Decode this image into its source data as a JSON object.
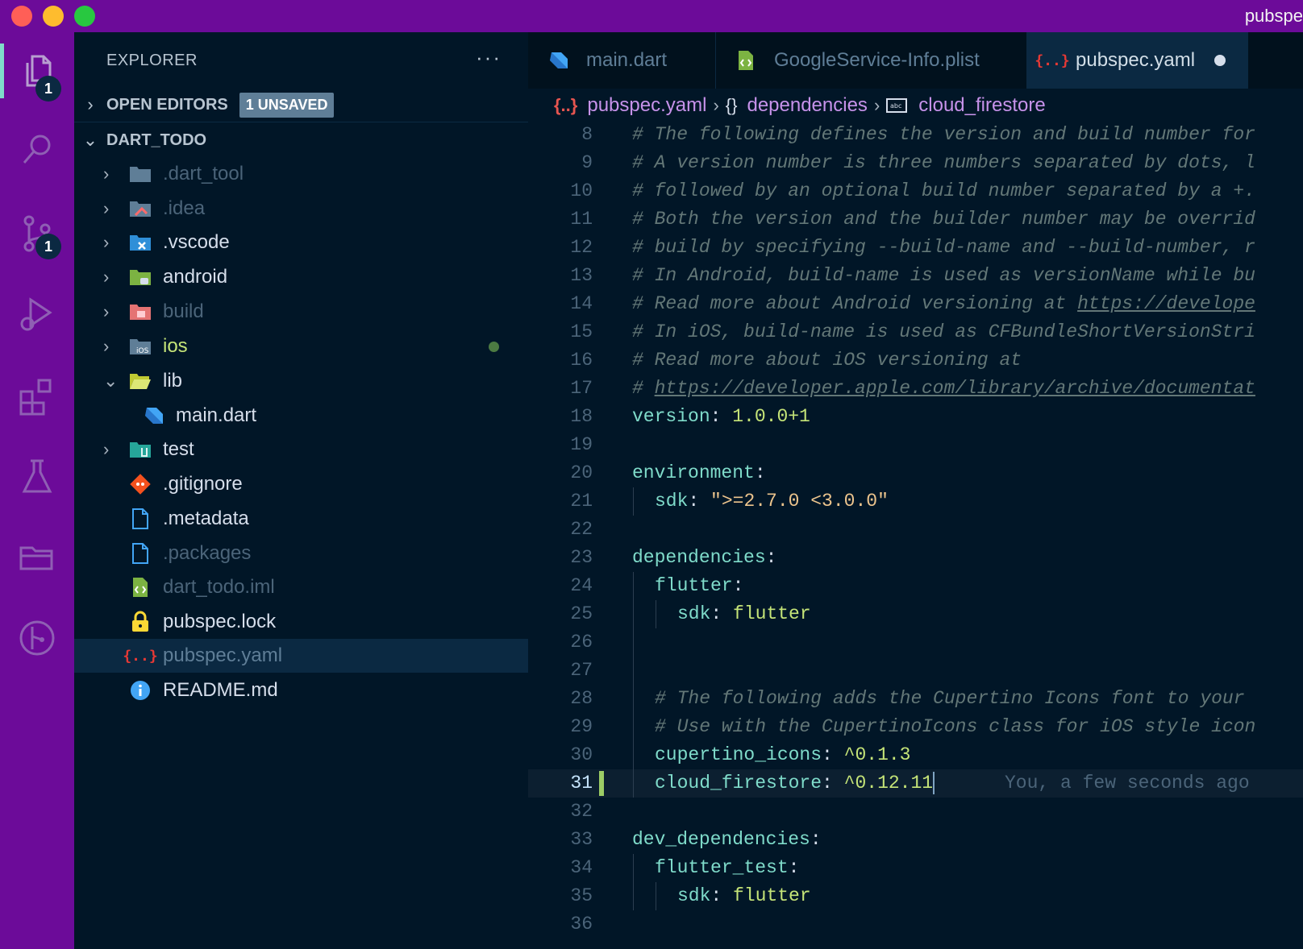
{
  "window": {
    "title": "pubspe"
  },
  "activity_bar": {
    "explorer_badge": "1",
    "scm_badge": "1"
  },
  "sidebar": {
    "header": "EXPLORER",
    "more": "···",
    "open_editors": {
      "label": "OPEN EDITORS",
      "badge": "1 UNSAVED"
    },
    "project": {
      "label": "DART_TODO"
    },
    "tree": [
      {
        "name": ".dart_tool",
        "color": "#4b6479",
        "icon": "folder-icon"
      },
      {
        "name": ".idea",
        "color": "#4b6479",
        "icon": "idea-folder-icon"
      },
      {
        "name": ".vscode",
        "color": "#d6deeb",
        "icon": "vscode-folder-icon"
      },
      {
        "name": "android",
        "color": "#d6deeb",
        "icon": "android-folder-icon"
      },
      {
        "name": "build",
        "color": "#4b6479",
        "icon": "build-folder-icon"
      },
      {
        "name": "ios",
        "color": "#c5e478",
        "icon": "ios-folder-icon"
      },
      {
        "name": "lib",
        "color": "#d6deeb",
        "icon": "lib-folder-open-icon"
      },
      {
        "name": "main.dart",
        "color": "#d6deeb",
        "icon": "dart-icon"
      },
      {
        "name": "test",
        "color": "#d6deeb",
        "icon": "test-folder-icon"
      },
      {
        "name": ".gitignore",
        "color": "#d6deeb",
        "icon": "git-icon"
      },
      {
        "name": ".metadata",
        "color": "#d6deeb",
        "icon": "file-icon"
      },
      {
        "name": ".packages",
        "color": "#4b6479",
        "icon": "file-icon"
      },
      {
        "name": "dart_todo.iml",
        "color": "#4b6479",
        "icon": "xml-icon"
      },
      {
        "name": "pubspec.lock",
        "color": "#d6deeb",
        "icon": "lock-icon"
      },
      {
        "name": "pubspec.yaml",
        "color": "#5f7e97",
        "icon": "yaml-icon"
      },
      {
        "name": "README.md",
        "color": "#d6deeb",
        "icon": "info-icon"
      }
    ]
  },
  "tabs": [
    {
      "label": "main.dart"
    },
    {
      "label": "GoogleService-Info.plist"
    },
    {
      "label": "pubspec.yaml"
    }
  ],
  "breadcrumb": {
    "file": "pubspec.yaml",
    "file_icon": "{..}",
    "section_icon": "{}",
    "section": "dependencies",
    "item": "cloud_firestore"
  },
  "code": {
    "line_numbers": [
      "8",
      "9",
      "10",
      "11",
      "12",
      "13",
      "14",
      "15",
      "16",
      "17",
      "18",
      "19",
      "20",
      "21",
      "22",
      "23",
      "24",
      "25",
      "26",
      "27",
      "28",
      "29",
      "30",
      "31",
      "32",
      "33",
      "34",
      "35",
      "36"
    ],
    "l8": "# The following defines the version and build number for",
    "l9": "# A version number is three numbers separated by dots, l",
    "l10": "# followed by an optional build number separated by a +.",
    "l11": "# Both the version and the builder number may be overrid",
    "l12": "# build by specifying --build-name and --build-number, r",
    "l13": "# In Android, build-name is used as versionName while bu",
    "l14_a": "# Read more about Android versioning at ",
    "l14_b": "https://develope",
    "l15": "# In iOS, build-name is used as CFBundleShortVersionStri",
    "l16": "# Read more about iOS versioning at",
    "l17_a": "# ",
    "l17_b": "https://developer.apple.com/library/archive/documentat",
    "l18_key": "version",
    "l18_val": "1.0.0+1",
    "l20_key": "environment",
    "l21_key": "sdk",
    "l21_val": "\">=2.7.0 <3.0.0\"",
    "l23_key": "dependencies",
    "l24_key": "flutter",
    "l25_key": "sdk",
    "l25_val": "flutter",
    "l28": "# The following adds the Cupertino Icons font to your",
    "l29": "# Use with the CupertinoIcons class for iOS style icon",
    "l30_key": "cupertino_icons",
    "l30_val": "^0.1.3",
    "l31_key": "cloud_firestore",
    "l31_val": "^0.12.11",
    "l31_blame": "You, a few seconds ago",
    "l33_key": "dev_dependencies",
    "l34_key": "flutter_test",
    "l35_key": "sdk",
    "l35_val": "flutter"
  },
  "colors": {
    "activity_bar": "#6c0b99",
    "editor_bg": "#011627",
    "selection": "#0b2942",
    "yaml_key": "#7fdbca",
    "yaml_value": "#c5e478",
    "yaml_string": "#ecc48d",
    "comment": "#637777"
  }
}
